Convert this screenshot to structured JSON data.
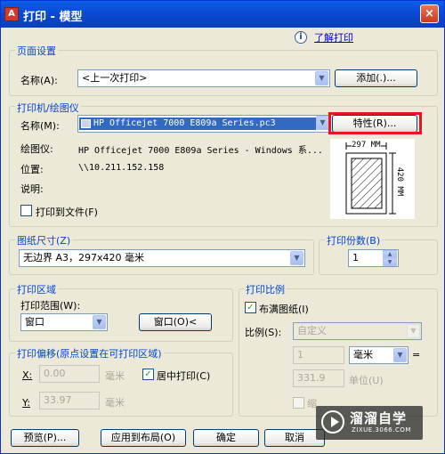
{
  "window": {
    "app_icon_glyph": "A",
    "title": "打印 - 模型",
    "close_label": "×"
  },
  "help": {
    "icon_glyph": "i",
    "link": "了解打印"
  },
  "page_setup": {
    "label": "页面设置",
    "name_label": "名称(A):",
    "name_value": "<上一次打印>",
    "add_button": "添加(.)..."
  },
  "printer": {
    "label": "打印机/绘图仪",
    "name_label": "名称(M):",
    "name_value": "HP Officejet 7000 E809a Series.pc3",
    "properties_button": "特性(R)...",
    "plotter_label": "绘图仪:",
    "plotter_value": "HP Officejet 7000 E809a Series - Windows 系...",
    "location_label": "位置:",
    "location_value": "\\\\10.211.152.158",
    "description_label": "说明:",
    "print_to_file": "打印到文件(F)",
    "preview_width": "297 MM",
    "preview_height": "420 MM"
  },
  "paper_size": {
    "label": "图纸尺寸(Z)",
    "value": "无边界 A3，297x420 毫米"
  },
  "copies": {
    "label": "打印份数(B)",
    "value": "1"
  },
  "plot_area": {
    "label": "打印区域",
    "range_label": "打印范围(W):",
    "range_value": "窗口",
    "window_button": "窗口(O)<"
  },
  "plot_scale": {
    "label": "打印比例",
    "fit_to_paper": "布满图纸(I)",
    "fit_checked": true,
    "scale_label": "比例(S):",
    "scale_value": "自定义",
    "value1": "1",
    "unit_value": "毫米",
    "equals": "=",
    "value2": "331.9",
    "units_label": "单位(U)",
    "scale_lineweights": "缩"
  },
  "plot_offset": {
    "label": "打印偏移(原点设置在可打印区域)",
    "x_label": "X:",
    "x_value": "0.00",
    "x_unit": "毫米",
    "y_label": "Y:",
    "y_value": "33.97",
    "y_unit": "毫米",
    "center_label": "居中打印(C)",
    "center_checked": true
  },
  "footer": {
    "preview": "预览(P)...",
    "apply": "应用到布局(O)",
    "ok": "确定",
    "cancel": "取消"
  },
  "watermark": {
    "title": "溜溜自学",
    "subtitle": "ZIXUE.3066.COM"
  }
}
